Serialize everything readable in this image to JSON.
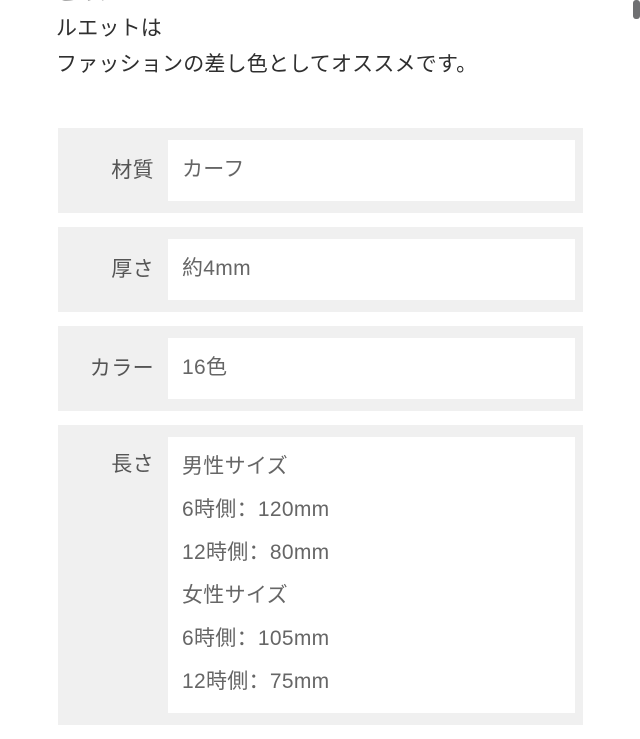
{
  "page": {
    "clipped_top_line": "このシ",
    "intro_lines": [
      "ルエットは",
      "ファッションの差し色としてオススメです。"
    ]
  },
  "spec_table": {
    "rows": [
      {
        "label": "材質",
        "values": [
          "カーフ"
        ]
      },
      {
        "label": "厚さ",
        "values": [
          "約4mm"
        ]
      },
      {
        "label": "カラー",
        "values": [
          "16色"
        ]
      },
      {
        "label": "長さ",
        "values": [
          "男性サイズ",
          "6時側：120mm",
          "12時側：80mm",
          "女性サイズ",
          "6時側：105mm",
          "12時側：75mm"
        ]
      }
    ]
  },
  "scrollbar": {
    "position_label": "top"
  },
  "colors": {
    "row_background": "#f0f0f0",
    "value_background": "#ffffff",
    "label_text": "#555555",
    "value_text": "#666666",
    "body_text": "#2f2f2f",
    "scrollbar_thumb": "#6f7072"
  }
}
